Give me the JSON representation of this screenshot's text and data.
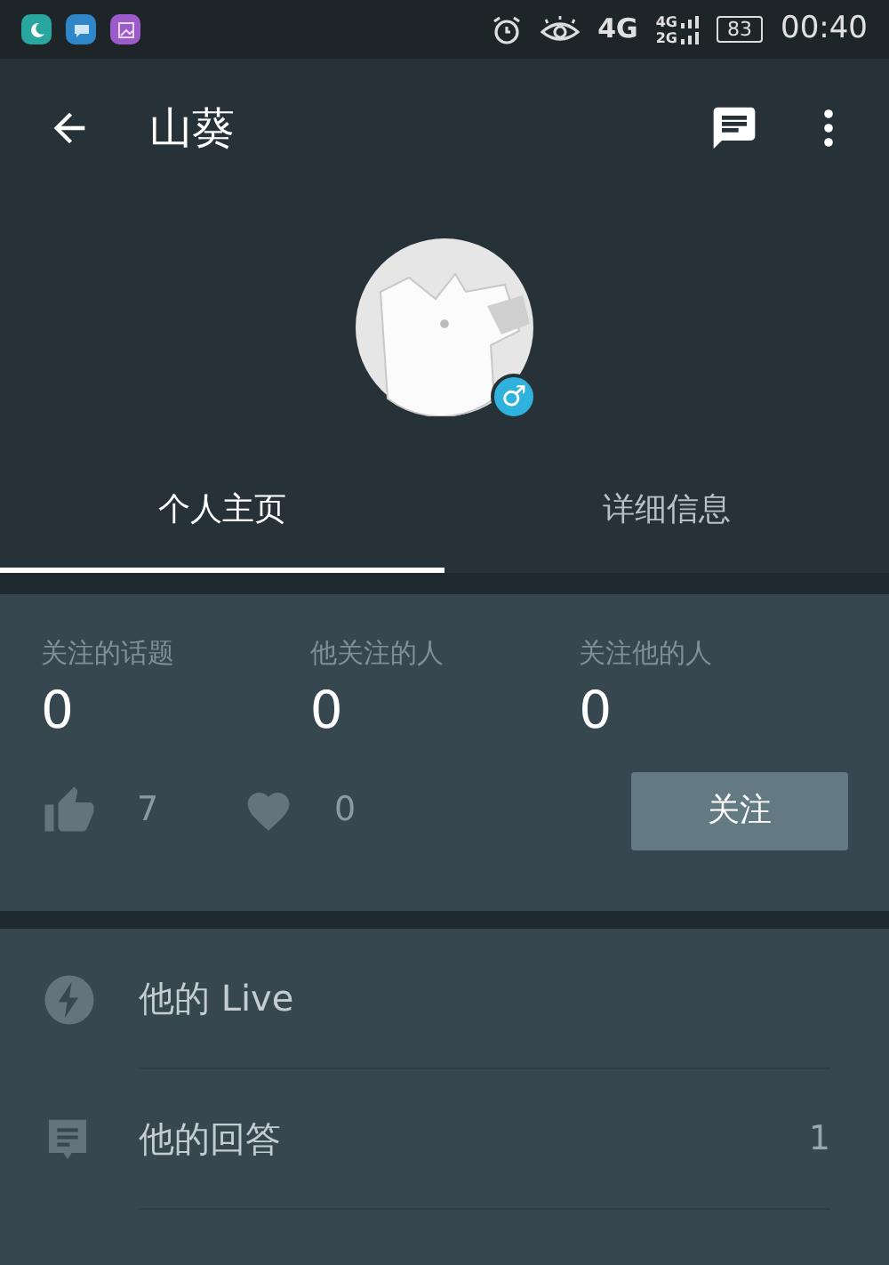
{
  "status_bar": {
    "battery": "83",
    "network": "4G",
    "sim_top": "4G",
    "sim_bottom": "2G",
    "time": "00:40"
  },
  "header": {
    "title": "山葵"
  },
  "profile": {
    "gender_badge": "♂"
  },
  "tabs": [
    {
      "label": "个人主页",
      "selected": true
    },
    {
      "label": "详细信息",
      "selected": false
    }
  ],
  "stats": [
    {
      "label": "关注的话题",
      "value": "0"
    },
    {
      "label": "他关注的人",
      "value": "0"
    },
    {
      "label": "关注他的人",
      "value": "0"
    }
  ],
  "reactions": [
    {
      "kind": "thumb",
      "count": "7"
    },
    {
      "kind": "heart",
      "count": "0"
    }
  ],
  "follow_button": "关注",
  "menu": [
    {
      "kind": "live",
      "label": "他的 Live"
    },
    {
      "kind": "answers",
      "label": "他的回答",
      "count": "1"
    }
  ]
}
